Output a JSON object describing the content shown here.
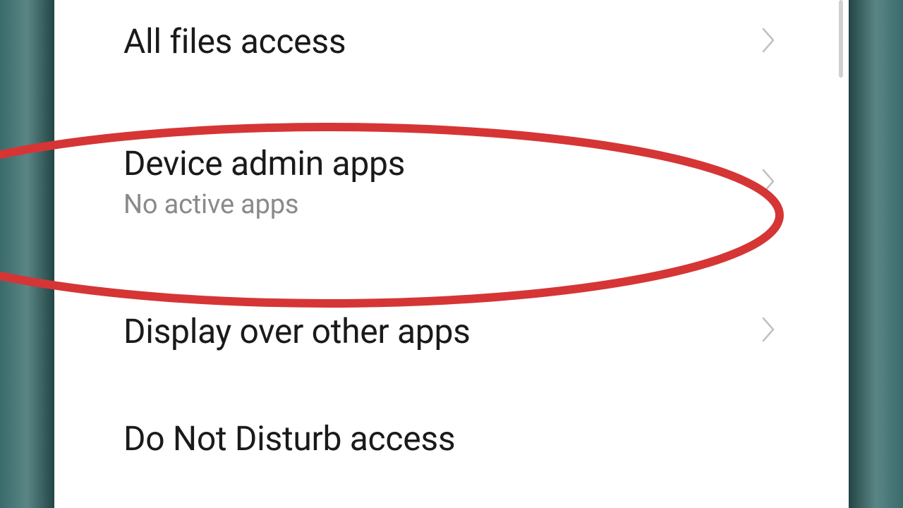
{
  "settings": {
    "items": [
      {
        "title": "All files access",
        "subtitle": null
      },
      {
        "title": "Device admin apps",
        "subtitle": "No active apps"
      },
      {
        "title": "Display over other apps",
        "subtitle": null
      },
      {
        "title": "Do Not Disturb access",
        "subtitle": null
      }
    ]
  },
  "highlight": {
    "color": "#d63535",
    "target_index": 1
  }
}
